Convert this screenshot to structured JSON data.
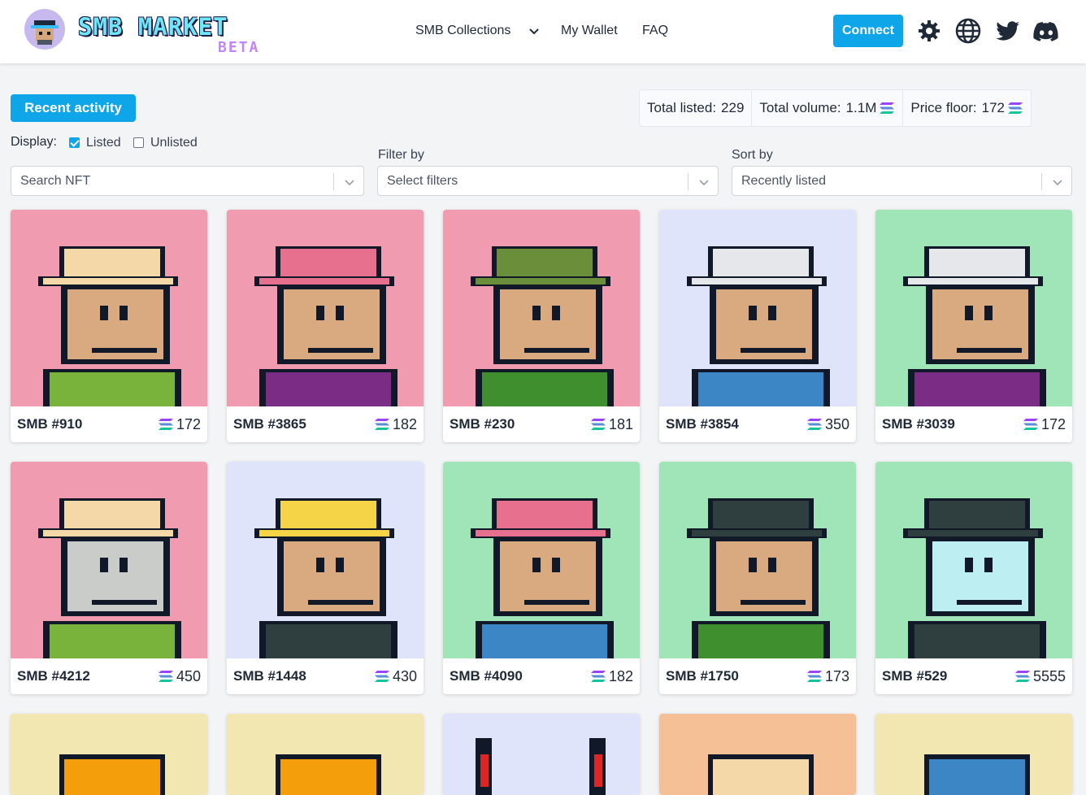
{
  "header": {
    "logo_text": "SMB MARKET",
    "logo_sub": "BETA",
    "nav": {
      "collections": "SMB Collections",
      "wallet": "My Wallet",
      "faq": "FAQ"
    },
    "connect_label": "Connect",
    "icons": [
      "gear-icon",
      "globe-icon",
      "twitter-icon",
      "discord-icon"
    ]
  },
  "toolbar": {
    "recent_activity": "Recent activity",
    "stats": {
      "listed_label": "Total listed:",
      "listed_value": "229",
      "volume_label": "Total volume:",
      "volume_value": "1.1M",
      "floor_label": "Price floor:",
      "floor_value": "172"
    },
    "display_label": "Display:",
    "listed_option": "Listed",
    "listed_checked": true,
    "unlisted_option": "Unlisted",
    "unlisted_checked": false,
    "search_placeholder": "Search NFT",
    "filter_label": "Filter by",
    "filter_placeholder": "Select filters",
    "sort_label": "Sort by",
    "sort_value": "Recently listed"
  },
  "colors": {
    "accent": "#0ea5e9",
    "pink": "#f19bb0",
    "lavender": "#e0e4fb",
    "mint": "#9fe5b7",
    "yellow": "#f2e7b0",
    "peach": "#f5c095"
  },
  "cards": [
    {
      "name": "SMB #910",
      "price": "172",
      "bg": "#f19bb0"
    },
    {
      "name": "SMB #3865",
      "price": "182",
      "bg": "#f19bb0"
    },
    {
      "name": "SMB #230",
      "price": "181",
      "bg": "#f19bb0"
    },
    {
      "name": "SMB #3854",
      "price": "350",
      "bg": "#e0e4fb"
    },
    {
      "name": "SMB #3039",
      "price": "172",
      "bg": "#9fe5b7"
    },
    {
      "name": "SMB #4212",
      "price": "450",
      "bg": "#f19bb0"
    },
    {
      "name": "SMB #1448",
      "price": "430",
      "bg": "#e0e4fb"
    },
    {
      "name": "SMB #4090",
      "price": "182",
      "bg": "#9fe5b7"
    },
    {
      "name": "SMB #1750",
      "price": "173",
      "bg": "#9fe5b7"
    },
    {
      "name": "SMB #529",
      "price": "5555",
      "bg": "#9fe5b7"
    }
  ],
  "partial_cards": [
    {
      "bg": "#f2e7b0"
    },
    {
      "bg": "#f2e7b0"
    },
    {
      "bg": "#e0e4fb"
    },
    {
      "bg": "#f5c095"
    },
    {
      "bg": "#f2e7b0"
    }
  ]
}
